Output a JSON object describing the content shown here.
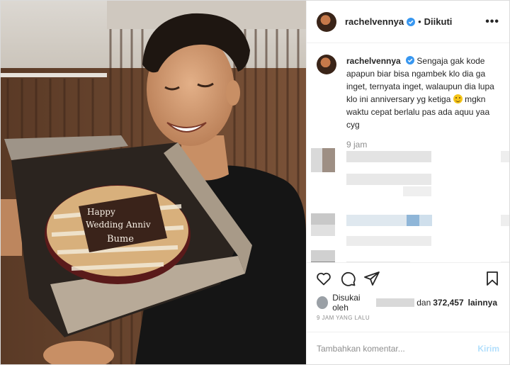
{
  "post": {
    "username": "rachelvennya",
    "follow_status": "Diikuti",
    "more_label": "•••",
    "caption": {
      "username": "rachelvennya",
      "text_part1": "Sengaja gak kode apapun biar bisa ngambek klo dia ga inget, ternyata inget, walaupun dia lupa klo ini anniversary yg ketiga",
      "text_part2": "mgkn waktu cepat berlalu pas ada aquu yaa cyg",
      "time": "9 jam"
    },
    "cake_text": {
      "line1": "Happy",
      "line2": "Wedding Anniv",
      "line3": "Bume"
    },
    "likes": {
      "prefix": "Disukai oleh",
      "connector": "dan",
      "count": "372,457",
      "suffix": "lainnya"
    },
    "timestamp": "9 JAM YANG LALU",
    "comment_box": {
      "placeholder": "Tambahkan komentar...",
      "submit_label": "Kirim"
    }
  },
  "icons": [
    "heart-icon",
    "comment-icon",
    "share-icon",
    "bookmark-icon",
    "verified-badge-icon",
    "more-options-icon"
  ],
  "colors": {
    "verified": "#3897f0",
    "post_button_disabled": "#b2dffc",
    "muted_text": "#8e8e8e"
  }
}
